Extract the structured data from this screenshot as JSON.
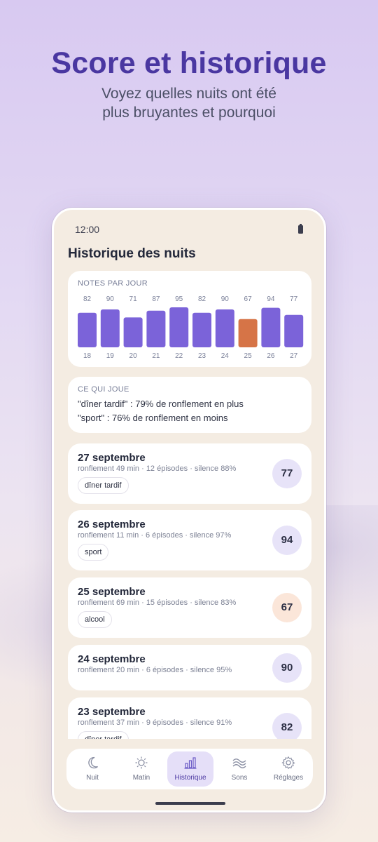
{
  "promo": {
    "title": "Score et historique",
    "subtitle_line1": "Voyez quelles nuits ont été",
    "subtitle_line2": "plus bruyantes et pourquoi"
  },
  "status_bar": {
    "time": "12:00",
    "icon": "battery-icon"
  },
  "page_title": "Historique des nuits",
  "chart_data": {
    "type": "bar",
    "title": "NOTES PAR JOUR",
    "categories": [
      "18",
      "19",
      "20",
      "21",
      "22",
      "23",
      "24",
      "25",
      "26",
      "27"
    ],
    "values": [
      82,
      90,
      71,
      87,
      95,
      82,
      90,
      67,
      94,
      77
    ],
    "highlight_index": 7,
    "colors": {
      "normal": "#7b63d9",
      "highlight": "#d67447"
    },
    "ylim": [
      0,
      100
    ],
    "grid": false
  },
  "insight": {
    "caption": "CE QUI JOUE",
    "lines": [
      "\"dîner tardif\" : 79% de ronflement en plus",
      "\"sport\" : 76% de ronflement en moins"
    ]
  },
  "nights": [
    {
      "date": "27 septembre",
      "stats": "ronflement 49 min · 12 épisodes · silence 88%",
      "tag": "dîner tardif",
      "score": "77",
      "warn": false
    },
    {
      "date": "26 septembre",
      "stats": "ronflement 11 min · 6 épisodes · silence 97%",
      "tag": "sport",
      "score": "94",
      "warn": false
    },
    {
      "date": "25 septembre",
      "stats": "ronflement 69 min · 15 épisodes · silence 83%",
      "tag": "alcool",
      "score": "67",
      "warn": true
    },
    {
      "date": "24 septembre",
      "stats": "ronflement 20 min · 6 épisodes · silence 95%",
      "tag": "",
      "score": "90",
      "warn": false
    },
    {
      "date": "23 septembre",
      "stats": "ronflement 37 min · 9 épisodes · silence 91%",
      "tag": "dîner tardif",
      "score": "82",
      "warn": false
    }
  ],
  "nav": {
    "items": [
      {
        "label": "Nuit",
        "icon": "moon-icon"
      },
      {
        "label": "Matin",
        "icon": "sun-icon"
      },
      {
        "label": "Historique",
        "icon": "bar-chart-icon",
        "active": true
      },
      {
        "label": "Sons",
        "icon": "waves-icon"
      },
      {
        "label": "Réglages",
        "icon": "gear-icon"
      }
    ]
  }
}
